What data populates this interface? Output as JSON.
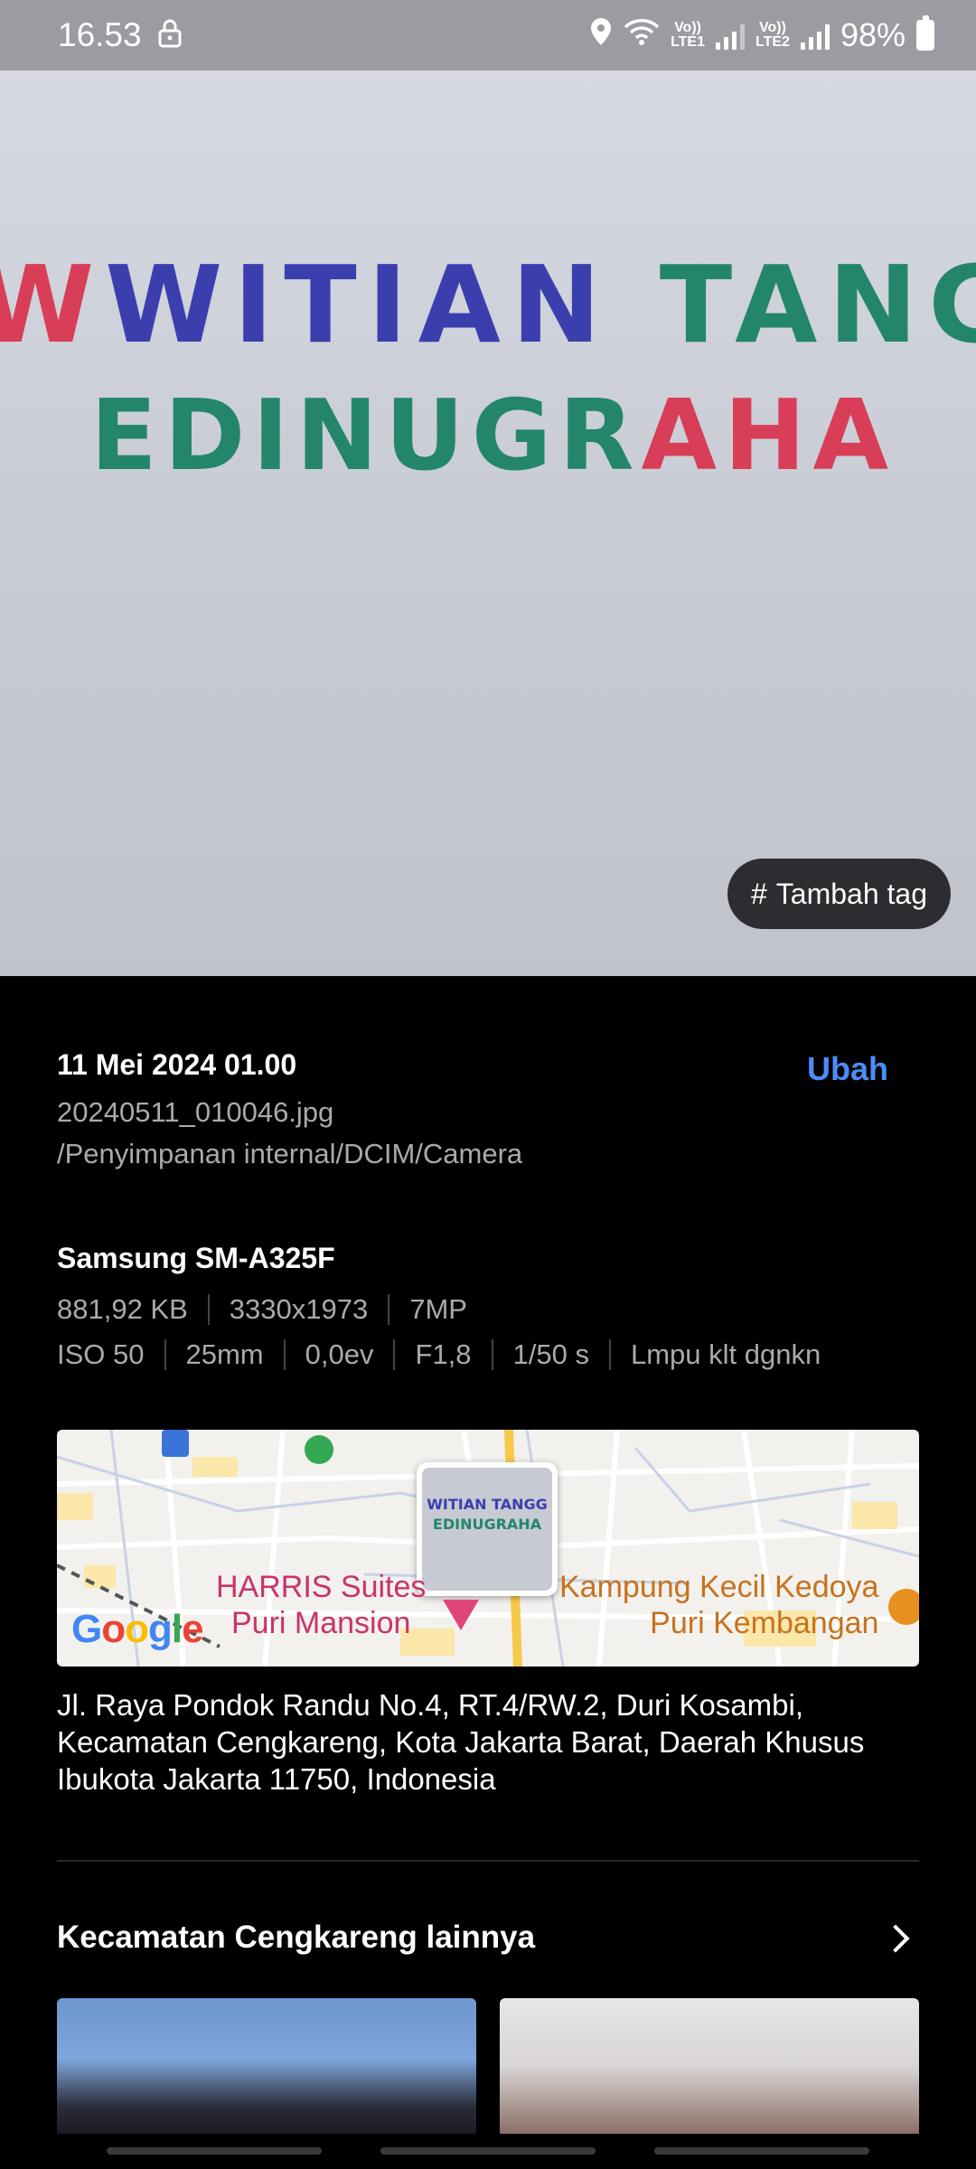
{
  "status_bar": {
    "time": "16.53",
    "lte1_top": "Vo))",
    "lte1_bottom": "LTE1",
    "lte2_top": "Vo))",
    "lte2_bottom": "LTE2",
    "battery": "98%"
  },
  "photo": {
    "board_line1": [
      "WITIAN ",
      "TANGG"
    ],
    "board_line2": [
      "EDINUGR",
      "AHA"
    ],
    "tag_button_label": "Tambah tag",
    "tag_icon": "#"
  },
  "details": {
    "datetime": "11 Mei 2024 01.00",
    "edit_label": "Ubah",
    "filename": "20240511_010046.jpg",
    "path": "/Penyimpanan internal/DCIM/Camera",
    "device": "Samsung SM-A325F",
    "size": "881,92 KB",
    "resolution": "3330x1973",
    "megapixels": "7MP",
    "iso": "ISO 50",
    "focal": "25mm",
    "ev": "0,0ev",
    "aperture": "F1,8",
    "shutter": "1/50 s",
    "flash": "Lmpu klt dgnkn"
  },
  "map": {
    "poi_1_line1": "HARRIS Suites",
    "poi_1_line2": "Puri Mansion",
    "poi_2_line1": "Kampung Kecil Kedoya",
    "poi_2_line2": "Puri Kembangan",
    "provider": "Google",
    "thumb_line1": "WITIAN TANGG",
    "thumb_line2": "EDINUGRAHA"
  },
  "address": "Jl. Raya Pondok Randu No.4, RT.4/RW.2, Duri Kosambi, Kecamatan Cengkareng, Kota Jakarta Barat, Daerah Khusus Ibukota Jakarta 11750, Indonesia",
  "related": {
    "title": "Kecamatan Cengkareng lainnya"
  },
  "colors": {
    "accent": "#4a8df7",
    "status_bar": "#9a9ca1",
    "background": "#000000"
  }
}
